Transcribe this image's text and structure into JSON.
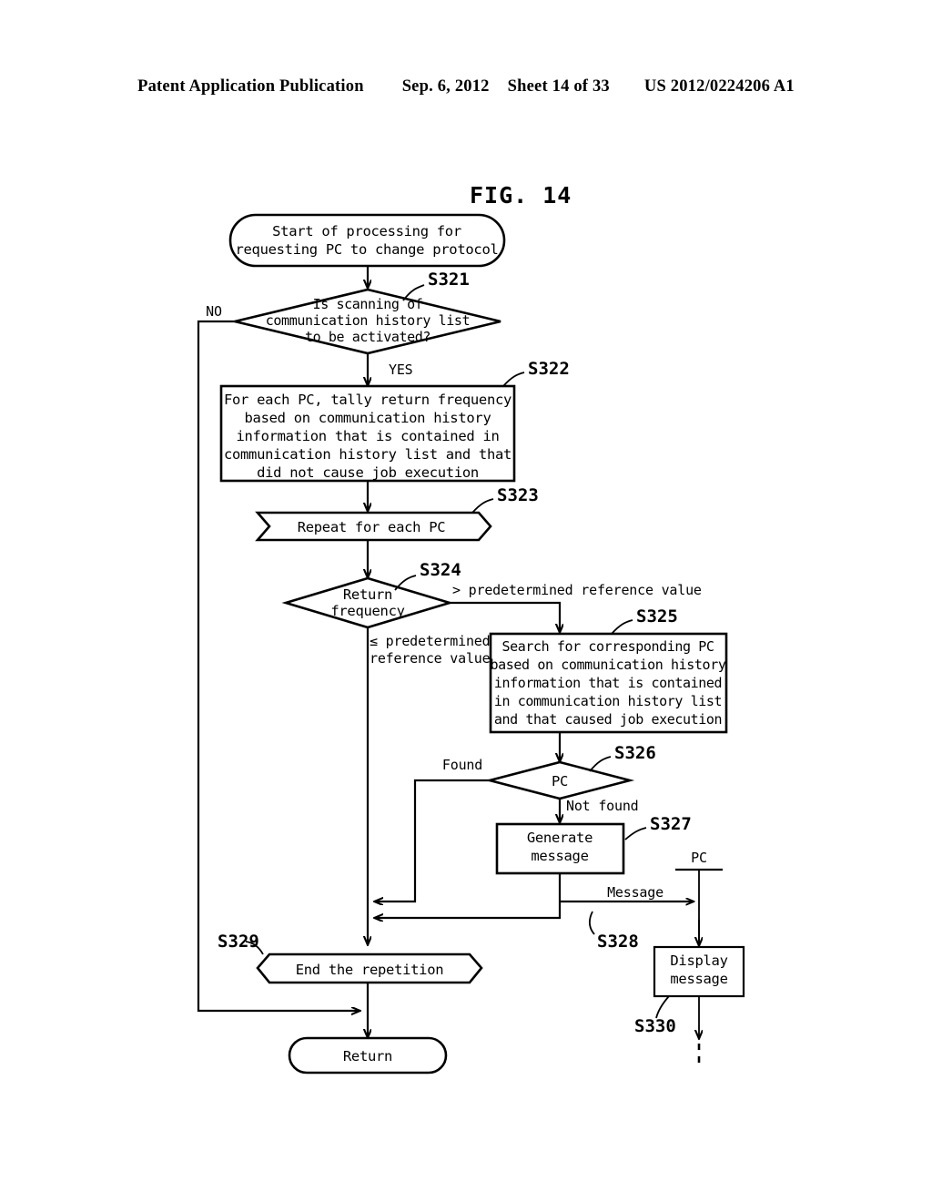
{
  "header": {
    "publication": "Patent Application Publication",
    "date": "Sep. 6, 2012",
    "sheet": "Sheet 14 of 33",
    "patent_number": "US 2012/0224206 A1"
  },
  "figure": {
    "title": "FIG. 14"
  },
  "nodes": {
    "start": {
      "type": "terminator",
      "lines": [
        "Start of processing for",
        "requesting PC to change protocol"
      ]
    },
    "s321": {
      "type": "decision",
      "step": "S321",
      "lines": [
        "Is scanning of",
        "communication history list",
        "to be activated?"
      ],
      "branch_no": "NO",
      "branch_yes": "YES"
    },
    "s322": {
      "type": "process",
      "step": "S322",
      "lines": [
        "For each PC, tally return frequency",
        "based on communication history",
        "information that is contained in",
        "communication history list and that",
        "did not cause job execution"
      ]
    },
    "s323": {
      "type": "loop-start",
      "step": "S323",
      "lines": [
        "Repeat for each PC"
      ]
    },
    "s324": {
      "type": "decision",
      "step": "S324",
      "lines": [
        "Return",
        "frequency"
      ],
      "branch_greater": "> predetermined reference value",
      "branch_lesser_line1": "≤ predetermined",
      "branch_lesser_line2": "reference value"
    },
    "s325": {
      "type": "process",
      "step": "S325",
      "lines": [
        "Search for corresponding PC",
        "based on communication history",
        "information that is contained",
        "in communication history list",
        "and that caused job execution"
      ]
    },
    "s326": {
      "type": "decision",
      "step": "S326",
      "lines": [
        "PC"
      ],
      "branch_found": "Found",
      "branch_not_found": "Not found"
    },
    "s327": {
      "type": "process",
      "step": "S327",
      "lines": [
        "Generate",
        "message"
      ]
    },
    "s328": {
      "type": "message-arrow",
      "step": "S328",
      "label": "Message"
    },
    "s329": {
      "type": "loop-end",
      "step": "S329",
      "lines": [
        "End the repetition"
      ]
    },
    "s330": {
      "type": "process",
      "step": "S330",
      "lines": [
        "Display",
        "message"
      ]
    },
    "pc_lifeline": {
      "type": "lifeline",
      "label": "PC"
    },
    "return": {
      "type": "terminator",
      "lines": [
        "Return"
      ]
    }
  },
  "colors": {
    "ink": "#000000",
    "paper": "#ffffff"
  }
}
